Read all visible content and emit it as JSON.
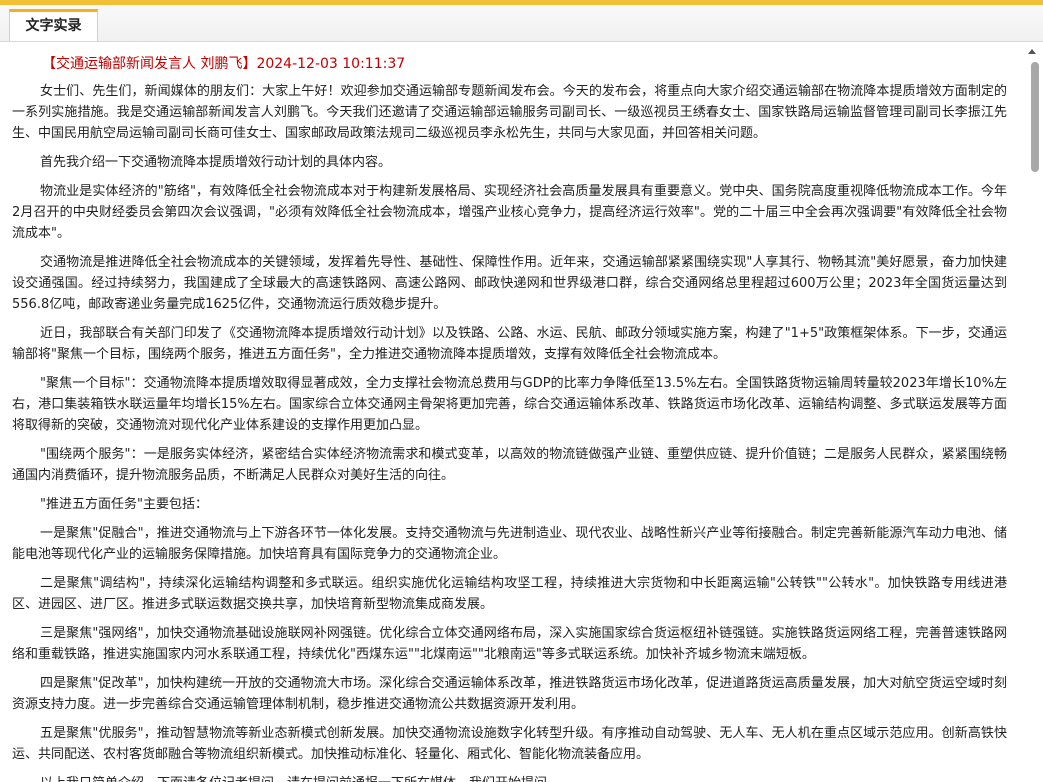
{
  "tab": {
    "label": "文字实录"
  },
  "speaker_line": "【交通运输部新闻发言人 刘鹏飞】2024-12-03 10:11:37",
  "paragraphs": [
    "女士们、先生们，新闻媒体的朋友们：大家上午好！欢迎参加交通运输部专题新闻发布会。今天的发布会，将重点向大家介绍交通运输部在物流降本提质增效方面制定的一系列实施措施。我是交通运输部新闻发言人刘鹏飞。今天我们还邀请了交通运输部运输服务司副司长、一级巡视员王绣春女士、国家铁路局运输监督管理司副司长李振江先生、中国民用航空局运输司副司长商可佳女士、国家邮政局政策法规司二级巡视员李永松先生，共同与大家见面，并回答相关问题。",
    "首先我介绍一下交通物流降本提质增效行动计划的具体内容。",
    "物流业是实体经济的\"筋络\"，有效降低全社会物流成本对于构建新发展格局、实现经济社会高质量发展具有重要意义。党中央、国务院高度重视降低物流成本工作。今年2月召开的中央财经委员会第四次会议强调，\"必须有效降低全社会物流成本，增强产业核心竞争力，提高经济运行效率\"。党的二十届三中全会再次强调要\"有效降低全社会物流成本\"。",
    "交通物流是推进降低全社会物流成本的关键领域，发挥着先导性、基础性、保障性作用。近年来，交通运输部紧紧围绕实现\"人享其行、物畅其流\"美好愿景，奋力加快建设交通强国。经过持续努力，我国建成了全球最大的高速铁路网、高速公路网、邮政快递网和世界级港口群，综合交通网络总里程超过600万公里；2023年全国货运量达到556.8亿吨，邮政寄递业务量完成1625亿件，交通物流运行质效稳步提升。",
    "近日，我部联合有关部门印发了《交通物流降本提质增效行动计划》以及铁路、公路、水运、民航、邮政分领域实施方案，构建了\"1+5\"政策框架体系。下一步，交通运输部将\"聚焦一个目标，围绕两个服务，推进五方面任务\"，全力推进交通物流降本提质增效，支撑有效降低全社会物流成本。",
    "\"聚焦一个目标\"：交通物流降本提质增效取得显著成效，全力支撑社会物流总费用与GDP的比率力争降低至13.5%左右。全国铁路货物运输周转量较2023年增长10%左右，港口集装箱铁水联运量年均增长15%左右。国家综合立体交通网主骨架将更加完善，综合交通运输体系改革、铁路货运市场化改革、运输结构调整、多式联运发展等方面将取得新的突破，交通物流对现代化产业体系建设的支撑作用更加凸显。",
    "\"围绕两个服务\"：一是服务实体经济，紧密结合实体经济物流需求和模式变革，以高效的物流链做强产业链、重塑供应链、提升价值链；二是服务人民群众，紧紧围绕畅通国内消费循环，提升物流服务品质，不断满足人民群众对美好生活的向往。",
    "\"推进五方面任务\"主要包括：",
    "一是聚焦\"促融合\"，推进交通物流与上下游各环节一体化发展。支持交通物流与先进制造业、现代农业、战略性新兴产业等衔接融合。制定完善新能源汽车动力电池、储能电池等现代化产业的运输服务保障措施。加快培育具有国际竞争力的交通物流企业。",
    "二是聚焦\"调结构\"，持续深化运输结构调整和多式联运。组织实施优化运输结构攻坚工程，持续推进大宗货物和中长距离运输\"公转铁\"\"公转水\"。加快铁路专用线进港区、进园区、进厂区。推进多式联运数据交换共享，加快培育新型物流集成商发展。",
    "三是聚焦\"强网络\"，加快交通物流基础设施联网补网强链。优化综合立体交通网络布局，深入实施国家综合货运枢纽补链强链。实施铁路货运网络工程，完善普速铁路网络和重载铁路，推进实施国家内河水系联通工程，持续优化\"西煤东运\"\"北煤南运\"\"北粮南运\"等多式联运系统。加快补齐城乡物流末端短板。",
    "四是聚焦\"促改革\"，加快构建统一开放的交通物流大市场。深化综合交通运输体系改革，推进铁路货运市场化改革，促进道路货运高质量发展，加大对航空货运空域时刻资源支持力度。进一步完善综合交通运输管理体制机制，稳步推进交通物流公共数据资源开发利用。",
    "五是聚焦\"优服务\"，推动智慧物流等新业态新模式创新发展。加快交通物流设施数字化转型升级。有序推动自动驾驶、无人车、无人机在重点区域示范应用。创新高铁快运、共同配送、农村客货邮融合等物流组织新模式。加快推动标准化、轻量化、厢式化、智能化物流装备应用。",
    "以上我只简单介绍。下面请各位记者提问。请在提问前通报一下所在媒体，我们开始提问。"
  ]
}
